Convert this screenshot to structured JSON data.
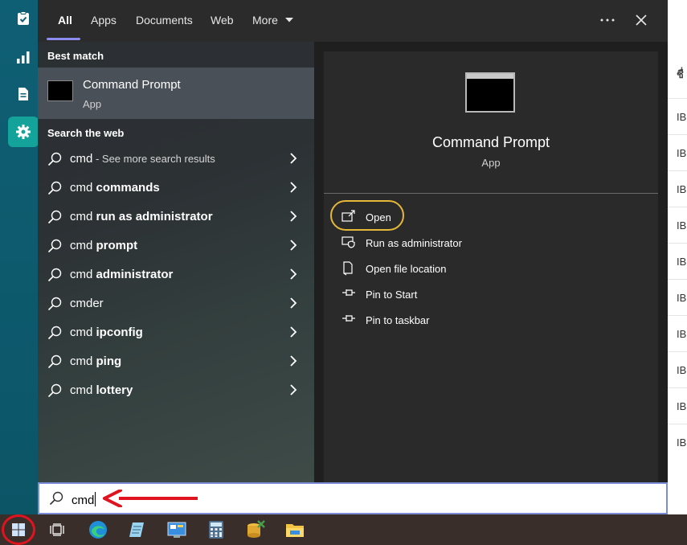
{
  "background_app": {
    "header_fragment": "ชื่",
    "row_fragment": "IBI",
    "rows": [
      "IBI",
      "IBI",
      "IBI",
      "IBI",
      "IBI",
      "IBI",
      "IBI",
      "IBI",
      "IBI",
      "IBI"
    ]
  },
  "sidebar": {
    "items": [
      {
        "icon": "clipboard-check-icon",
        "active": false
      },
      {
        "icon": "bar-chart-icon",
        "active": false
      },
      {
        "icon": "document-icon",
        "active": false
      },
      {
        "icon": "gear-icon",
        "active": true
      }
    ]
  },
  "tabs": {
    "items": [
      "All",
      "Apps",
      "Documents",
      "Web",
      "More"
    ],
    "active": "All",
    "more_icon": "caret-down-icon",
    "overflow_icon": "ellipsis-icon",
    "close_icon": "close-icon"
  },
  "best_match": {
    "section_label": "Best match",
    "title": "Command Prompt",
    "subtitle": "App"
  },
  "web": {
    "section_label": "Search the web",
    "results": [
      {
        "prefix": "cmd",
        "bold": "",
        "suffix": " - See more search results"
      },
      {
        "prefix": "cmd ",
        "bold": "commands",
        "suffix": ""
      },
      {
        "prefix": "cmd ",
        "bold": "run as administrator",
        "suffix": ""
      },
      {
        "prefix": "cmd ",
        "bold": "prompt",
        "suffix": ""
      },
      {
        "prefix": "cmd ",
        "bold": "administrator",
        "suffix": ""
      },
      {
        "prefix": "cmder",
        "bold": "",
        "suffix": ""
      },
      {
        "prefix": "cmd ",
        "bold": "ipconfig",
        "suffix": ""
      },
      {
        "prefix": "cmd ",
        "bold": "ping",
        "suffix": ""
      },
      {
        "prefix": "cmd ",
        "bold": "lottery",
        "suffix": ""
      }
    ]
  },
  "detail": {
    "title": "Command Prompt",
    "subtitle": "App",
    "actions": [
      {
        "label": "Open",
        "icon": "open-external-icon"
      },
      {
        "label": "Run as administrator",
        "icon": "shield-admin-icon"
      },
      {
        "label": "Open file location",
        "icon": "file-location-icon"
      },
      {
        "label": "Pin to Start",
        "icon": "pin-icon"
      },
      {
        "label": "Pin to taskbar",
        "icon": "pin-icon"
      }
    ]
  },
  "search": {
    "value": "cmd"
  },
  "taskbar": {
    "items": [
      "windows-start-icon",
      "task-view-icon",
      "edge-browser-icon",
      "notepad-icon",
      "control-panel-icon",
      "calculator-icon",
      "database-tool-icon",
      "file-explorer-icon"
    ]
  },
  "colors": {
    "accent_underline": "#8c8cf0",
    "highlight_ring": "#e6b838",
    "annotation_red": "#e0141e",
    "sidebar_teal": "#0f5f74",
    "sidebar_active": "#14a39a"
  }
}
